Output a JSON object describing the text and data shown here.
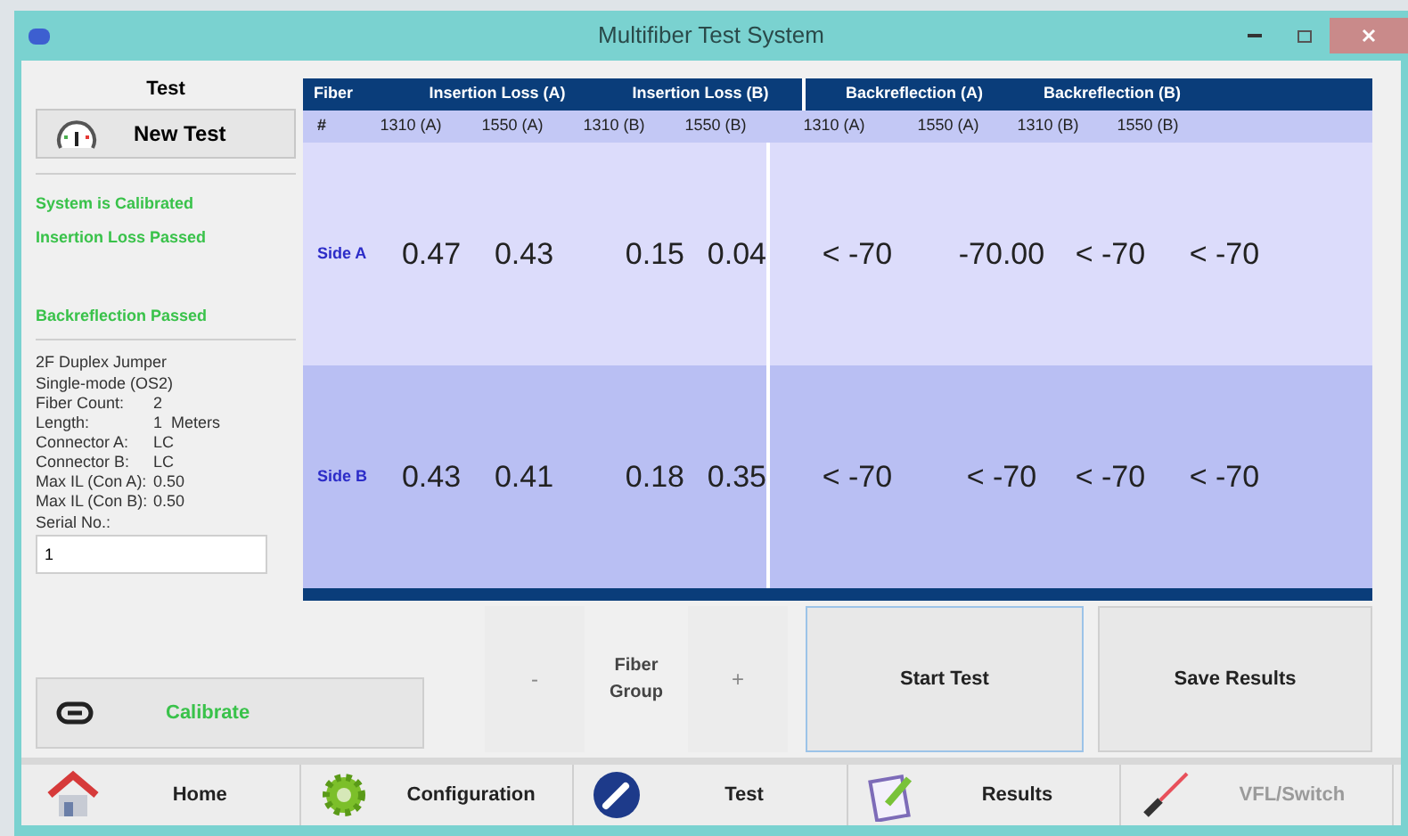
{
  "window": {
    "title": "Multifiber Test System"
  },
  "left_panel": {
    "heading": "Test",
    "new_test_button": "New Test",
    "status_messages": [
      "System is Calibrated",
      "Insertion Loss Passed",
      "Backreflection Passed"
    ],
    "jumper": [
      "2F Duplex Jumper",
      "Single-mode (OS2)"
    ],
    "specs": [
      {
        "label": "Fiber Count:",
        "value": "2"
      },
      {
        "label": "Length:",
        "value": "1  Meters"
      },
      {
        "label": "Connector A:",
        "value": "LC"
      },
      {
        "label": "Connector B:",
        "value": "LC"
      },
      {
        "label": "Max IL (Con A):",
        "value": "0.50"
      },
      {
        "label": "Max IL (Con B):",
        "value": "0.50"
      }
    ],
    "serial": {
      "label": "Serial No.:",
      "value": "1"
    },
    "calibrate_button": "Calibrate"
  },
  "table": {
    "fiber_heading": "Fiber",
    "groups": [
      "Insertion Loss (A)",
      "Insertion Loss (B)",
      "Backreflection (A)",
      "Backreflection (B)"
    ],
    "hash": "#",
    "columns": [
      "1310 (A)",
      "1550 (A)",
      "1310 (B)",
      "1550 (B)",
      "1310 (A)",
      "1550 (A)",
      "1310 (B)",
      "1550 (B)"
    ],
    "rows": [
      {
        "label": "Side A",
        "values": [
          "0.47",
          "0.43",
          "0.15",
          "0.04",
          "< -70",
          "-70.00",
          "< -70",
          "< -70"
        ]
      },
      {
        "label": "Side B",
        "values": [
          "0.43",
          "0.41",
          "0.18",
          "0.35",
          "< -70",
          "< -70",
          "< -70",
          "< -70"
        ]
      }
    ]
  },
  "controls": {
    "minus": "-",
    "fiber_group": "Fiber Group",
    "plus": "+",
    "start_test": "Start Test",
    "save_results": "Save Results"
  },
  "nav": [
    {
      "kind": "home",
      "label": "Home",
      "disabled": false
    },
    {
      "kind": "gear",
      "label": "Configuration",
      "disabled": false
    },
    {
      "kind": "test",
      "label": "Test",
      "disabled": false
    },
    {
      "kind": "results",
      "label": "Results",
      "disabled": false
    },
    {
      "kind": "laser",
      "label": "VFL/Switch",
      "disabled": true
    }
  ]
}
